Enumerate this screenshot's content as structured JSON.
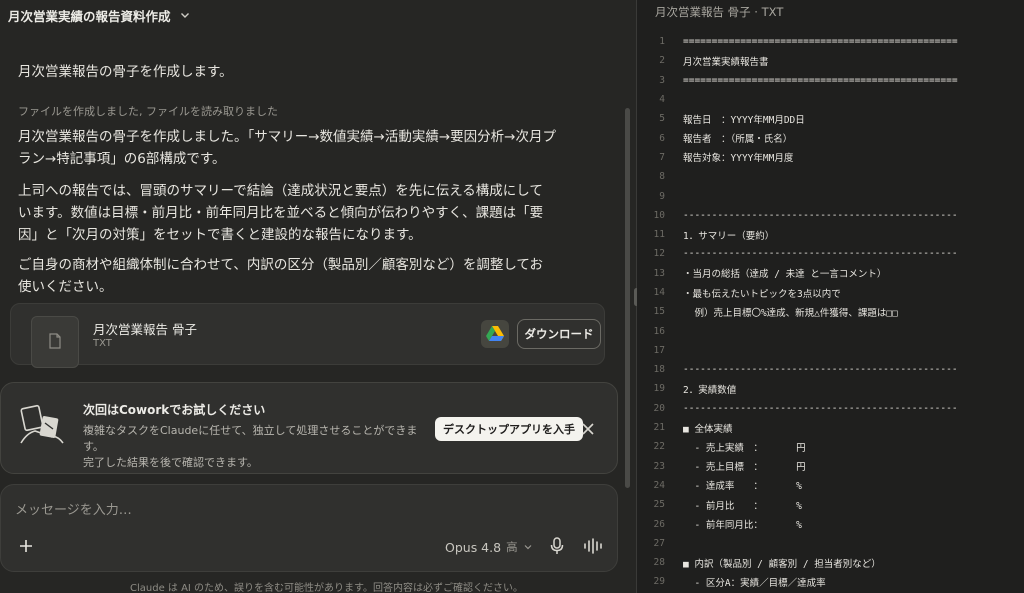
{
  "header": {
    "title": "月次営業実績の報告資料作成"
  },
  "chat": {
    "intro": "月次営業報告の骨子を作成します。",
    "tool_status": "ファイルを作成しました, ファイルを読み取りました",
    "paragraph1_line1": "月次営業報告の骨子を作成しました。「サマリー→数値実績→活動実績→要因分析→次月プ",
    "paragraph1_line2": "ラン→特記事項」の6部構成です。",
    "paragraph2_line1": "上司への報告では、冒頭のサマリーで結論（達成状況と要点）を先に伝える構成にして",
    "paragraph2_line2": "います。数値は目標・前月比・前年同月比を並べると傾向が伝わりやすく、課題は「要",
    "paragraph2_line3": "因」と「次月の対策」をセットで書くと建設的な報告になります。",
    "paragraph3_line1": "ご自身の商材や組織体制に合わせて、内訳の区分（製品別／顧客別など）を調整してお",
    "paragraph3_line2": "使いください。"
  },
  "file_card": {
    "name": "月次営業報告 骨子",
    "type": "TXT",
    "download_label": "ダウンロード"
  },
  "cowork": {
    "title": "次回はCoworkでお試しください",
    "desc_line1": "複雑なタスクをClaudeに任せて、独立して処理させることができます。",
    "desc_line2": "完了した結果を後で確認できます。",
    "button_label": "デスクトップアプリを入手"
  },
  "composer": {
    "placeholder": "メッセージを入力…",
    "model": "Opus 4.8",
    "level": "高"
  },
  "disclaimer": "Claude は AI のため、誤りを含む可能性があります。回答内容は必ずご確認ください。",
  "document": {
    "title": "月次営業報告 骨子 · TXT",
    "lines": [
      {
        "n": "1",
        "t": "================================================"
      },
      {
        "n": "2",
        "t": "月次営業実績報告書"
      },
      {
        "n": "3",
        "t": "================================================"
      },
      {
        "n": "4",
        "t": ""
      },
      {
        "n": "5",
        "t": "報告日　：YYYY年MM月DD日"
      },
      {
        "n": "6",
        "t": "報告者　：（所属・氏名）"
      },
      {
        "n": "7",
        "t": "報告対象：YYYY年MM月度"
      },
      {
        "n": "8",
        "t": ""
      },
      {
        "n": "9",
        "t": ""
      },
      {
        "n": "10",
        "t": "------------------------------------------------"
      },
      {
        "n": "11",
        "t": "1．サマリー（要約）"
      },
      {
        "n": "12",
        "t": "------------------------------------------------"
      },
      {
        "n": "13",
        "t": "・当月の総括（達成 / 未達 と一言コメント）"
      },
      {
        "n": "14",
        "t": "・最も伝えたいトピックを3点以内で"
      },
      {
        "n": "15",
        "t": "  例）売上目標〇%達成、新規△件獲得、課題は□□"
      },
      {
        "n": "16",
        "t": ""
      },
      {
        "n": "17",
        "t": ""
      },
      {
        "n": "18",
        "t": "------------------------------------------------"
      },
      {
        "n": "19",
        "t": "2．実績数値"
      },
      {
        "n": "20",
        "t": "------------------------------------------------"
      },
      {
        "n": "21",
        "t": "■ 全体実績"
      },
      {
        "n": "22",
        "t": "  - 売上実績　：　　　　円"
      },
      {
        "n": "23",
        "t": "  - 売上目標　：　　　　円"
      },
      {
        "n": "24",
        "t": "  - 達成率　　：　　　　%"
      },
      {
        "n": "25",
        "t": "  - 前月比　　：　　　　%"
      },
      {
        "n": "26",
        "t": "  - 前年同月比：　　　　%"
      },
      {
        "n": "27",
        "t": ""
      },
      {
        "n": "28",
        "t": "■ 内訳（製品別 / 顧客別 / 担当者別など）"
      },
      {
        "n": "29",
        "t": "  - 区分A：実績／目標／達成率"
      }
    ]
  }
}
